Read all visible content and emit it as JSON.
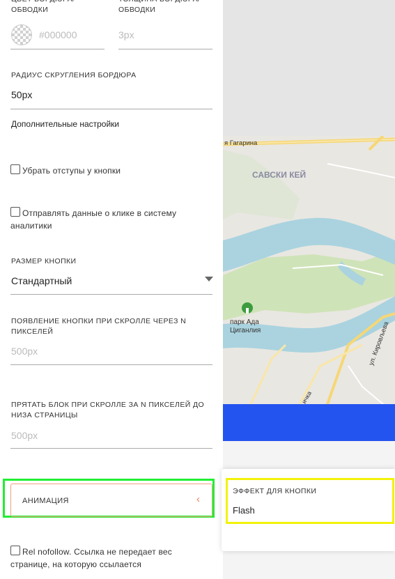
{
  "stroke": {
    "color_label": "ЦВЕТ БОРДЮРА/ ОБВОДКИ",
    "color_value": "#000000",
    "width_label": "ТОЛЩИНА БОРДЮРА/ ОБВОДКИ",
    "width_value": "3px"
  },
  "radius": {
    "label": "РАДИУС СКРУГЛЕНИЯ БОРДЮРА",
    "value": "50px"
  },
  "advanced": {
    "title": "Дополнительные настройки",
    "remove_padding": "Убрать отступы у кнопки",
    "analytics_line1": "Отправлять данные о клике в систему",
    "analytics_line2": "аналитики"
  },
  "size": {
    "label": "РАЗМЕР КНОПКИ",
    "value": "Стандартный"
  },
  "scroll_show": {
    "label_line1": "ПОЯВЛЕНИЕ КНОПКИ ПРИ СКРОЛЛЕ ЧЕРЕЗ N",
    "label_line2": "ПИКСЕЛЕЙ",
    "placeholder": "500px"
  },
  "scroll_hide": {
    "label_line1": "ПРЯТАТЬ БЛОК ПРИ СКРОЛЛЕ ЗА N ПИКСЕЛЕЙ ДО",
    "label_line2": "НИЗА СТРАНИЦЫ",
    "placeholder": "500px"
  },
  "animation": {
    "label": "АНИМАЦИЯ",
    "chevron": "‹"
  },
  "nofollow": {
    "line1": "Rel nofollow. Ссылка не передает вес",
    "line2": "странице, на которую ссылается"
  },
  "effect": {
    "label": "ЭФФЕКТ ДЛЯ КНОПКИ",
    "value": "Flash"
  },
  "map": {
    "street_top": "я Гагарина",
    "district": "САВСКИ КЕЙ",
    "park_line1": "парк Ада",
    "park_line2": "Циганлия",
    "street_right": "ул. Кировљева",
    "street_bottom": "ичка"
  },
  "colors": {
    "accent": "#f07a50",
    "blue_band": "#2454f0",
    "highlight_green": "#22ee33",
    "highlight_yellow": "#f2f20a"
  }
}
